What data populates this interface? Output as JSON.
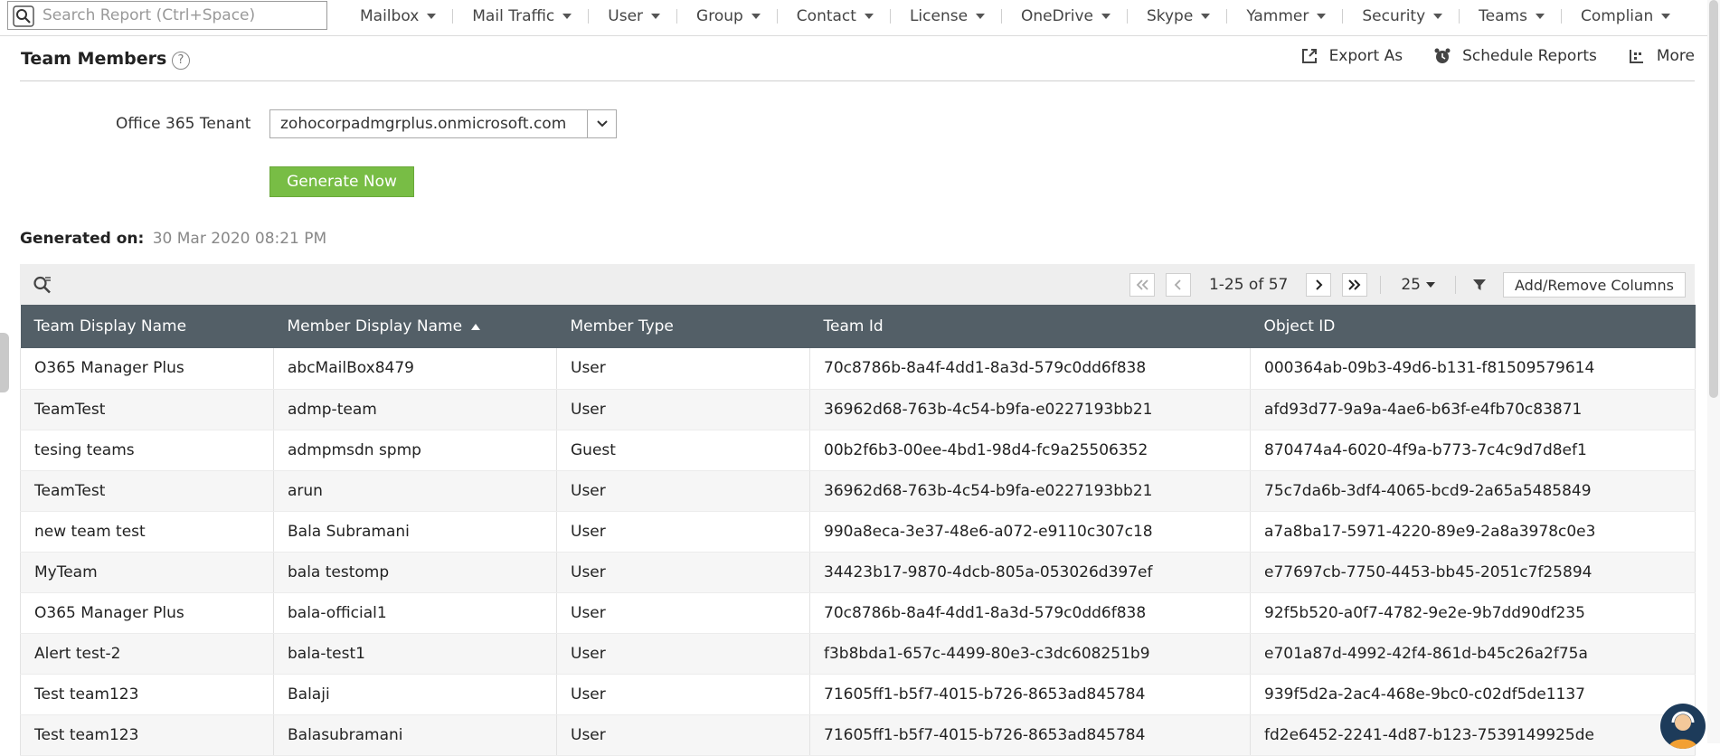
{
  "search": {
    "placeholder": "Search Report (Ctrl+Space)"
  },
  "nav": {
    "items": [
      {
        "label": "Mailbox",
        "icon": "chevron-down-icon"
      },
      {
        "label": "Mail Traffic",
        "icon": "chevron-down-icon"
      },
      {
        "label": "User",
        "icon": "chevron-down-icon"
      },
      {
        "label": "Group",
        "icon": "chevron-down-icon"
      },
      {
        "label": "Contact",
        "icon": "chevron-down-icon"
      },
      {
        "label": "License",
        "icon": "chevron-down-icon"
      },
      {
        "label": "OneDrive",
        "icon": "chevron-down-icon"
      },
      {
        "label": "Skype",
        "icon": "chevron-down-icon"
      },
      {
        "label": "Yammer",
        "icon": "chevron-down-icon"
      },
      {
        "label": "Security",
        "icon": "chevron-down-icon"
      },
      {
        "label": "Teams",
        "icon": "chevron-down-icon"
      },
      {
        "label": "Complian",
        "icon": "chevron-down-icon"
      }
    ]
  },
  "header": {
    "title": "Team Members",
    "help_glyph": "?",
    "export_label": "Export As",
    "schedule_label": "Schedule Reports",
    "more_label": "More"
  },
  "form": {
    "tenant_label": "Office 365 Tenant",
    "tenant_value": "zohocorpadmgrplus.onmicrosoft.com",
    "generate_label": "Generate Now"
  },
  "generated": {
    "label": "Generated on:",
    "value": "30 Mar 2020 08:21 PM"
  },
  "toolbar": {
    "page_info": "1-25 of 57",
    "per_page": "25",
    "columns_label": "Add/Remove Columns"
  },
  "table": {
    "columns": [
      "Team Display Name",
      "Member Display Name",
      "Member Type",
      "Team Id",
      "Object ID"
    ],
    "sorted_column": "Member Display Name",
    "sort_direction": "ascending",
    "rows": [
      [
        "O365 Manager Plus",
        "abcMailBox8479",
        "User",
        "70c8786b-8a4f-4dd1-8a3d-579c0dd6f838",
        "000364ab-09b3-49d6-b131-f81509579614"
      ],
      [
        "TeamTest",
        "admp-team",
        "User",
        "36962d68-763b-4c54-b9fa-e0227193bb21",
        "afd93d77-9a9a-4ae6-b63f-e4fb70c83871"
      ],
      [
        "tesing teams",
        "admpmsdn spmp",
        "Guest",
        "00b2f6b3-00ee-4bd1-98d4-fc9a25506352",
        "870474a4-6020-4f9a-b773-7c4c9d7d8ef1"
      ],
      [
        "TeamTest",
        "arun",
        "User",
        "36962d68-763b-4c54-b9fa-e0227193bb21",
        "75c7da6b-3df4-4065-bcd9-2a65a5485849"
      ],
      [
        "new team test",
        "Bala Subramani",
        "User",
        "990a8eca-3e37-48e6-a072-e9110c307c18",
        "a7a8ba17-5971-4220-89e9-2a8a3978c0e3"
      ],
      [
        "MyTeam",
        "bala testomp",
        "User",
        "34423b17-9870-4dcb-805a-053026d397ef",
        "e77697cb-7750-4453-bb45-2051c7f25894"
      ],
      [
        "O365 Manager Plus",
        "bala-official1",
        "User",
        "70c8786b-8a4f-4dd1-8a3d-579c0dd6f838",
        "92f5b520-a0f7-4782-9e2e-9b7dd90df235"
      ],
      [
        "Alert test-2",
        "bala-test1",
        "User",
        "f3b8bda1-657c-4499-80e3-c3dc608251b9",
        "e701a87d-4992-42f4-861d-b45c26a2f75a"
      ],
      [
        "Test team123",
        "Balaji",
        "User",
        "71605ff1-b5f7-4015-b726-8653ad845784",
        "939f5d2a-2ac4-468e-9bc0-c02df5de1137"
      ],
      [
        "Test team123",
        "Balasubramani",
        "User",
        "71605ff1-b5f7-4015-b726-8653ad845784",
        "fd2e6452-2241-4d87-b123-7539149925de"
      ]
    ]
  },
  "colors": {
    "accent_green": "#78bd45",
    "table_header": "#535f67",
    "toolbar_bg": "#eeeeee"
  }
}
